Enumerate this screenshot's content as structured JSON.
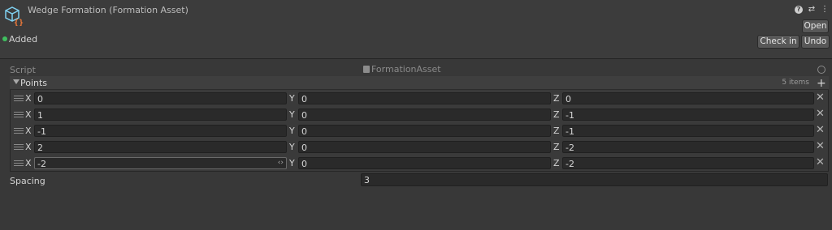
{
  "header": {
    "title": "Wedge Formation (Formation Asset)",
    "status": "Added",
    "status_color": "#3fbf5f",
    "icons": [
      "help-icon",
      "settings-sliders-icon",
      "more-options-icon"
    ],
    "buttons": {
      "open": "Open",
      "check_in": "Check in",
      "undo": "Undo"
    }
  },
  "script": {
    "label": "Script",
    "value": "FormationAsset"
  },
  "points": {
    "label": "Points",
    "count": "5 items",
    "axis_labels": {
      "x": "X",
      "y": "Y",
      "z": "Z"
    },
    "items": [
      {
        "x": "0",
        "y": "0",
        "z": "0"
      },
      {
        "x": "1",
        "y": "0",
        "z": "-1"
      },
      {
        "x": "-1",
        "y": "0",
        "z": "-1"
      },
      {
        "x": "2",
        "y": "0",
        "z": "-2"
      },
      {
        "x": "-2",
        "y": "0",
        "z": "-2"
      }
    ]
  },
  "spacing": {
    "label": "Spacing",
    "value": "3"
  }
}
